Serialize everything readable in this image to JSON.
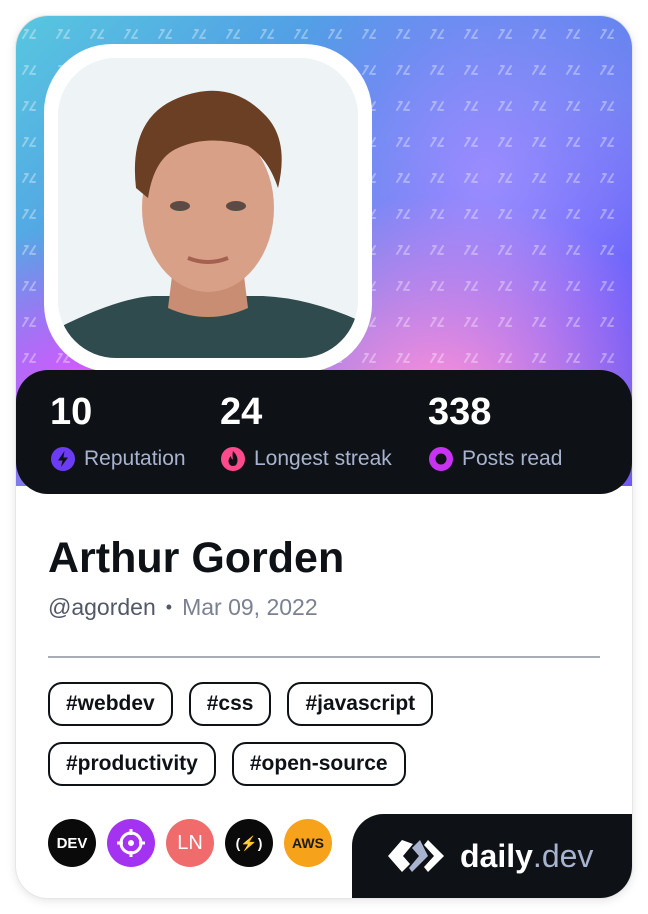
{
  "profile": {
    "name": "Arthur Gorden",
    "handle": "@agorden",
    "separator": "•",
    "joined": "Mar 09, 2022"
  },
  "stats": [
    {
      "value": "10",
      "label": "Reputation",
      "icon": "lightning-bolt-icon",
      "color": "#6c3cf5"
    },
    {
      "value": "24",
      "label": "Longest streak",
      "icon": "flame-icon",
      "color": "#ff4a8d"
    },
    {
      "value": "338",
      "label": "Posts read",
      "icon": "eye-ring-icon",
      "color": "#c833f2"
    }
  ],
  "tags": [
    [
      "#webdev",
      "#css",
      "#javascript"
    ],
    [
      "#productivity",
      "#open-source"
    ]
  ],
  "sources": [
    {
      "label": "DEV",
      "icon": "dev-to-logo",
      "bg": "#0a0a0a",
      "fg": "#ffffff"
    },
    {
      "label": "",
      "icon": "crosshair-logo",
      "bg": "#a333f0",
      "fg": "#ffffff"
    },
    {
      "label": "LN",
      "icon": "ln-logo",
      "bg": "#f06c6c",
      "fg": "#ffffff"
    },
    {
      "label": "(⚡)",
      "icon": "freecodecamp-logo",
      "bg": "#0a0a0a",
      "fg": "#ffffff"
    },
    {
      "label": "AWS",
      "icon": "aws-logo",
      "bg": "#f7a21b",
      "fg": "#1a1a1a"
    }
  ],
  "brand": {
    "name": "daily",
    "suffix": ".dev"
  },
  "colors": {
    "card_dark": "#0e1217",
    "muted_text": "#a8b3cf"
  }
}
